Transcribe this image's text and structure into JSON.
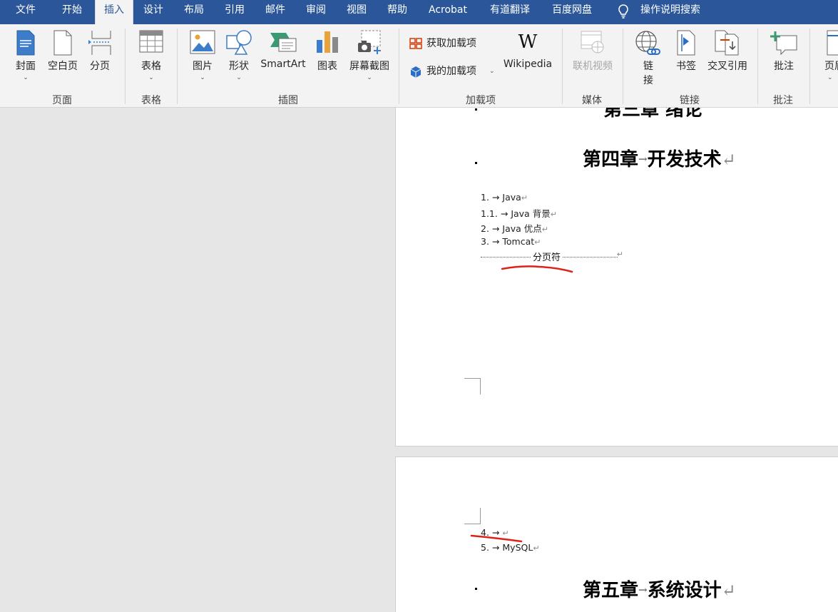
{
  "tabs": [
    {
      "label": "文件"
    },
    {
      "label": "开始"
    },
    {
      "label": "插入"
    },
    {
      "label": "设计"
    },
    {
      "label": "布局"
    },
    {
      "label": "引用"
    },
    {
      "label": "邮件"
    },
    {
      "label": "审阅"
    },
    {
      "label": "视图"
    },
    {
      "label": "帮助"
    },
    {
      "label": "Acrobat"
    },
    {
      "label": "有道翻译"
    },
    {
      "label": "百度网盘"
    }
  ],
  "active_tab": "插入",
  "tell_me": {
    "label": "操作说明搜索",
    "icon": "lightbulb-icon"
  },
  "ribbon": {
    "pages_group": {
      "label": "页面",
      "cover": "封面",
      "blank": "空白页",
      "break": "分页"
    },
    "tables_group": {
      "label": "表格",
      "table": "表格"
    },
    "illustrations_group": {
      "label": "插图",
      "picture": "图片",
      "shapes": "形状",
      "smartart": "SmartArt",
      "chart": "图表",
      "screenshot": "屏幕截图"
    },
    "addins_group": {
      "label": "加载项",
      "get": "获取加载项",
      "my": "我的加载项",
      "wikipedia": "Wikipedia",
      "wiki_glyph": "W"
    },
    "media_group": {
      "label": "媒体",
      "online_video": "联机视频"
    },
    "links_group": {
      "label": "链接",
      "link_1": "链",
      "link_2": "接",
      "bookmark": "书签",
      "crossref": "交叉引用"
    },
    "comments_group": {
      "label": "批注",
      "comment": "批注"
    },
    "header_group": {
      "header": "页眉"
    }
  },
  "document": {
    "page1": {
      "top_heading": "第三章 绪论",
      "heading4": {
        "title1": "第四章",
        "arrow": "→",
        "title2": "开发技术",
        "mark": "↵"
      },
      "list": [
        {
          "num": "1.",
          "arrow": "→",
          "text": "Java",
          "mark": "↵"
        },
        {
          "num": "1.1.",
          "arrow": "→",
          "text": "Java 背景",
          "mark": "↵"
        },
        {
          "num": "2.",
          "arrow": "→",
          "text": "Java 优点",
          "mark": "↵"
        },
        {
          "num": "3.",
          "arrow": "→",
          "text": "Tomcat",
          "mark": "↵"
        }
      ],
      "page_break": {
        "text": "分页符",
        "mark": "↵"
      }
    },
    "page2": {
      "list": [
        {
          "num": "4.",
          "arrow": "→",
          "text": "",
          "mark": "↵"
        },
        {
          "num": "5.",
          "arrow": "→",
          "text": "MySQL",
          "mark": "↵"
        }
      ],
      "heading5": {
        "title1": "第五章",
        "arrow": "→",
        "title2": "系统设计",
        "mark": "↵"
      }
    }
  },
  "colors": {
    "tab_bar": "#2b579a",
    "ribbon": "#f3f3f3",
    "annotation": "#e0201a",
    "workspace": "#e6e6e6"
  }
}
